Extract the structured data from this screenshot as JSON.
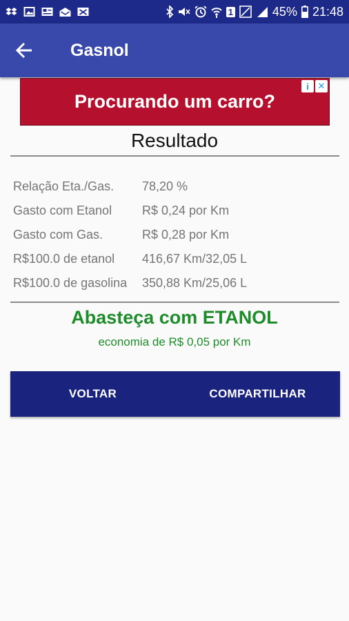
{
  "status_bar": {
    "battery_percent": "45%",
    "time": "21:48",
    "sim_slot": "1",
    "icons": [
      "dropbox-icon",
      "gallery-icon",
      "news-icon",
      "mail-open-icon",
      "mail-x-icon",
      "bluetooth-icon",
      "mute-icon",
      "alarm-icon",
      "wifi-icon",
      "sim-icon",
      "no-signal-icon",
      "signal-icon",
      "battery-icon"
    ]
  },
  "app_bar": {
    "title": "Gasnol",
    "back_icon": "arrow-back-icon",
    "color": "#3949ab"
  },
  "ad": {
    "text": "Procurando um carro?",
    "info_icon": "i",
    "close_icon": "✕",
    "color": "#b5112e"
  },
  "result": {
    "title": "Resultado",
    "rows": [
      {
        "label": "Relação Eta./Gas.",
        "value": "78,20 %"
      },
      {
        "label": "Gasto com Etanol",
        "value": "R$ 0,24 por Km"
      },
      {
        "label": "Gasto com Gas.",
        "value": "R$ 0,28 por Km"
      },
      {
        "label": "R$100.0 de etanol",
        "value": "416,67 Km/32,05 L"
      },
      {
        "label": "R$100.0 de gasolina",
        "value": "350,88 Km/25,06 L"
      }
    ],
    "verdict": "Abasteça com ETANOL",
    "economy": "economia de R$ 0,05 por Km",
    "verdict_color": "#1e8c2a"
  },
  "buttons": {
    "back": "VOLTAR",
    "share": "COMPARTILHAR",
    "color": "#1a237e"
  }
}
